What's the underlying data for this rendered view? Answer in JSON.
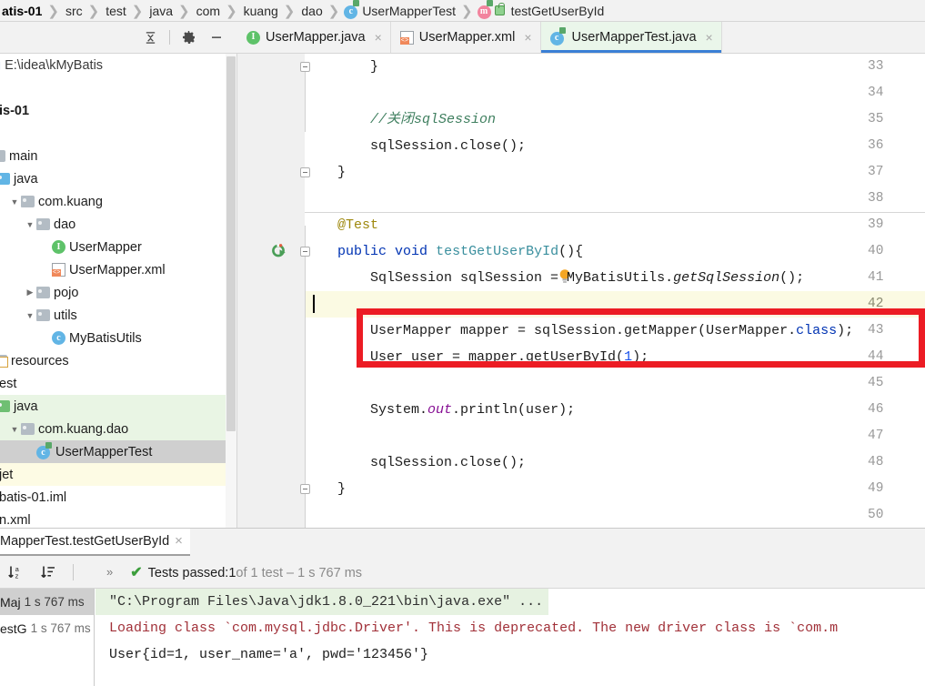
{
  "breadcrumb": {
    "items": [
      {
        "label": "atis-01",
        "icon": null,
        "bold": true
      },
      {
        "label": "src",
        "icon": null
      },
      {
        "label": "test",
        "icon": null
      },
      {
        "label": "java",
        "icon": null
      },
      {
        "label": "com",
        "icon": null
      },
      {
        "label": "kuang",
        "icon": null
      },
      {
        "label": "dao",
        "icon": null
      },
      {
        "label": "UserMapperTest",
        "icon": "class-icon"
      },
      {
        "label": "testGetUserById",
        "icon": "method-icon"
      }
    ]
  },
  "project_toolbar": {
    "collapse_all": "collapse-all-icon",
    "settings": "gear-icon",
    "hide": "minimize-icon"
  },
  "project_tree": {
    "rows": [
      {
        "label": "E:\\idea\\kMyBatis",
        "kind": "path"
      },
      {
        "label": "",
        "kind": "blank"
      },
      {
        "label": "is-01",
        "kind": "module"
      },
      {
        "label": "",
        "kind": "blank"
      },
      {
        "label": "main",
        "kind": "folder"
      },
      {
        "label": "java",
        "kind": "src-folder"
      },
      {
        "label": "com.kuang",
        "kind": "package",
        "arrow": "down"
      },
      {
        "label": "dao",
        "kind": "package",
        "arrow": "down"
      },
      {
        "label": "UserMapper",
        "kind": "interface"
      },
      {
        "label": "UserMapper.xml",
        "kind": "xml"
      },
      {
        "label": "pojo",
        "kind": "package",
        "arrow": "right"
      },
      {
        "label": "utils",
        "kind": "package",
        "arrow": "down"
      },
      {
        "label": "MyBatisUtils",
        "kind": "class"
      },
      {
        "label": "resources",
        "kind": "res-folder"
      },
      {
        "label": "est",
        "kind": "folder"
      },
      {
        "label": "java",
        "kind": "test-folder",
        "highlight": "green"
      },
      {
        "label": "com.kuang.dao",
        "kind": "package",
        "arrow": "down",
        "highlight": "green"
      },
      {
        "label": "UserMapperTest",
        "kind": "test-class",
        "highlight": "grey"
      },
      {
        "label": "jet",
        "kind": "plain",
        "highlight": "yellow"
      },
      {
        "label": "batis-01.iml",
        "kind": "plain"
      },
      {
        "label": "n.xml",
        "kind": "plain"
      }
    ]
  },
  "editor_tabs": [
    {
      "label": "UserMapper.java",
      "icon": "interface-icon",
      "active": false,
      "close": "×"
    },
    {
      "label": "UserMapper.xml",
      "icon": "xml-icon",
      "active": false,
      "close": "×"
    },
    {
      "label": "UserMapperTest.java",
      "icon": "test-class-icon",
      "active": true,
      "close": "×"
    }
  ],
  "editor": {
    "first_line_number": 33,
    "current_line": 42,
    "lines": [
      {
        "n": 33,
        "tokens": [
          {
            "t": "        }",
            "c": ""
          }
        ],
        "fold": "end"
      },
      {
        "n": 34,
        "tokens": [
          {
            "t": "",
            "c": ""
          }
        ]
      },
      {
        "n": 35,
        "tokens": [
          {
            "t": "        //关闭sqlSession",
            "c": "comment"
          }
        ]
      },
      {
        "n": 36,
        "tokens": [
          {
            "t": "        sqlSession.close();",
            "c": ""
          }
        ]
      },
      {
        "n": 37,
        "tokens": [
          {
            "t": "    }",
            "c": ""
          }
        ],
        "fold": "end"
      },
      {
        "n": 38,
        "tokens": [
          {
            "t": "",
            "c": ""
          }
        ]
      },
      {
        "n": 39,
        "tokens": [
          {
            "t": "    @Test",
            "c": "anno"
          }
        ]
      },
      {
        "n": 40,
        "tokens": [
          {
            "t": "    ",
            "c": ""
          },
          {
            "t": "public",
            "c": "kw"
          },
          {
            "t": " ",
            "c": ""
          },
          {
            "t": "void",
            "c": "kw"
          },
          {
            "t": " ",
            "c": ""
          },
          {
            "t": "testGetUserById",
            "c": "mname"
          },
          {
            "t": "(){",
            "c": ""
          }
        ],
        "gutter": "run-test-icon",
        "fold": "start"
      },
      {
        "n": 41,
        "tokens": [
          {
            "t": "        SqlSession sqlSession = MyBatisUtils.",
            "c": ""
          },
          {
            "t": "getSqlSession",
            "c": "italm"
          },
          {
            "t": "();",
            "c": ""
          }
        ],
        "gutter": "lightbulb-icon"
      },
      {
        "n": 42,
        "tokens": [
          {
            "t": "",
            "c": ""
          }
        ],
        "caret": true
      },
      {
        "n": 43,
        "tokens": [
          {
            "t": "        UserMapper mapper = sqlSession.getMapper(UserMapper.",
            "c": ""
          },
          {
            "t": "class",
            "c": "kw"
          },
          {
            "t": ");",
            "c": ""
          }
        ]
      },
      {
        "n": 44,
        "tokens": [
          {
            "t": "        User user = mapper.getUserById(",
            "c": ""
          },
          {
            "t": "1",
            "c": "num"
          },
          {
            "t": ");",
            "c": ""
          }
        ]
      },
      {
        "n": 45,
        "tokens": [
          {
            "t": "",
            "c": ""
          }
        ]
      },
      {
        "n": 46,
        "tokens": [
          {
            "t": "        System.",
            "c": ""
          },
          {
            "t": "out",
            "c": "field"
          },
          {
            "t": ".println(user);",
            "c": ""
          }
        ]
      },
      {
        "n": 47,
        "tokens": [
          {
            "t": "",
            "c": ""
          }
        ]
      },
      {
        "n": 48,
        "tokens": [
          {
            "t": "        sqlSession.close();",
            "c": ""
          }
        ]
      },
      {
        "n": 49,
        "tokens": [
          {
            "t": "    }",
            "c": ""
          }
        ],
        "fold": "end"
      },
      {
        "n": 50,
        "tokens": [
          {
            "t": "",
            "c": ""
          }
        ]
      }
    ],
    "highlight_box_color": "#ec1c24"
  },
  "run_panel": {
    "tab_label": "MapperTest.testGetUserById",
    "tab_close": "×",
    "toolbar": {
      "sort_alpha": "sort-alphabetically-icon",
      "sort_duration": "sort-by-duration-icon",
      "more": "»"
    },
    "status": {
      "check": "✔",
      "prefix": "Tests passed: ",
      "count": "1",
      "suffix": " of 1 test – 1 s 767 ms"
    },
    "tests": [
      {
        "name": "Maj",
        "time": "1 s 767 ms",
        "selected": true
      },
      {
        "name": "estG",
        "time": "1 s 767 ms",
        "selected": false
      }
    ],
    "console": [
      {
        "text": "\"C:\\Program Files\\Java\\jdk1.8.0_221\\bin\\java.exe\" ...",
        "kind": "command"
      },
      {
        "text": "Loading class `com.mysql.jdbc.Driver'. This is deprecated. The new driver class is `com.m",
        "kind": "error"
      },
      {
        "text": "User{id=1, user_name='a', pwd='123456'}",
        "kind": "output"
      }
    ]
  }
}
